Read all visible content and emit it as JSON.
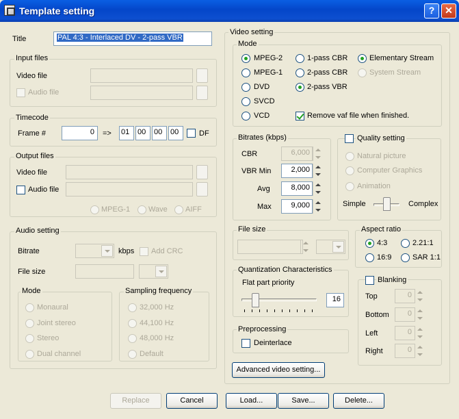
{
  "window": {
    "title": "Template setting",
    "help_button": "?",
    "close_button": "✕"
  },
  "title_field": {
    "label": "Title",
    "value": "PAL 4:3 - Interlaced DV - 2-pass VBR"
  },
  "input_files": {
    "legend": "Input files",
    "video_label": "Video file",
    "audio_label": "Audio file",
    "browse": "..."
  },
  "timecode": {
    "legend": "Timecode",
    "frame_label": "Frame #",
    "frame_value": "0",
    "arrow": "=>",
    "hh": "01",
    "mm": "00",
    "ss": "00",
    "ff": "00",
    "df_label": "DF"
  },
  "output_files": {
    "legend": "Output files",
    "video_label": "Video file",
    "audio_label": "Audio file",
    "browse": "...",
    "formats": [
      "MPEG-1",
      "Wave",
      "AIFF"
    ]
  },
  "audio_setting": {
    "legend": "Audio setting",
    "bitrate_label": "Bitrate",
    "kbps": "kbps",
    "add_crc": "Add CRC",
    "file_size_label": "File size",
    "mode": {
      "legend": "Mode",
      "options": [
        "Monaural",
        "Joint stereo",
        "Stereo",
        "Dual channel"
      ]
    },
    "sampling": {
      "legend": "Sampling frequency",
      "options": [
        "32,000 Hz",
        "44,100 Hz",
        "48,000 Hz",
        "Default"
      ]
    }
  },
  "video_setting": {
    "legend": "Video setting",
    "mode": {
      "legend": "Mode",
      "mpeg2": "MPEG-2",
      "mpeg1": "MPEG-1",
      "dvd": "DVD",
      "svcd": "SVCD",
      "vcd": "VCD",
      "pass1": "1-pass CBR",
      "pass2cbr": "2-pass CBR",
      "pass2vbr": "2-pass VBR",
      "elementary": "Elementary Stream",
      "system": "System Stream",
      "remove_vaf": "Remove vaf file when finished."
    },
    "bitrates": {
      "legend": "Bitrates (kbps)",
      "cbr_label": "CBR",
      "cbr": "6,000",
      "vbr_min_label": "VBR Min",
      "vbr_min": "2,000",
      "avg_label": "Avg",
      "avg": "8,000",
      "max_label": "Max",
      "max": "9,000"
    },
    "quality": {
      "legend": "Quality setting",
      "options": [
        "Natural picture",
        "Computer Graphics",
        "Animation"
      ],
      "simple": "Simple",
      "complex": "Complex"
    },
    "file_size": {
      "legend": "File size"
    },
    "aspect": {
      "legend": "Aspect ratio",
      "r43": "4:3",
      "r221": "2.21:1",
      "r169": "16:9",
      "sar": "SAR 1:1"
    },
    "quantization": {
      "legend": "Quantization Characteristics",
      "flat_label": "Flat part priority",
      "value": "16",
      "slider_level": 0.2
    },
    "blanking": {
      "legend": "Blanking",
      "top": "Top",
      "bottom": "Bottom",
      "left": "Left",
      "right": "Right",
      "value": "0"
    },
    "preprocessing": {
      "legend": "Preprocessing",
      "deinterlace": "Deinterlace"
    },
    "advanced_button": "Advanced video setting..."
  },
  "buttons": {
    "replace": "Replace",
    "cancel": "Cancel",
    "load": "Load...",
    "save": "Save...",
    "delete": "Delete..."
  }
}
